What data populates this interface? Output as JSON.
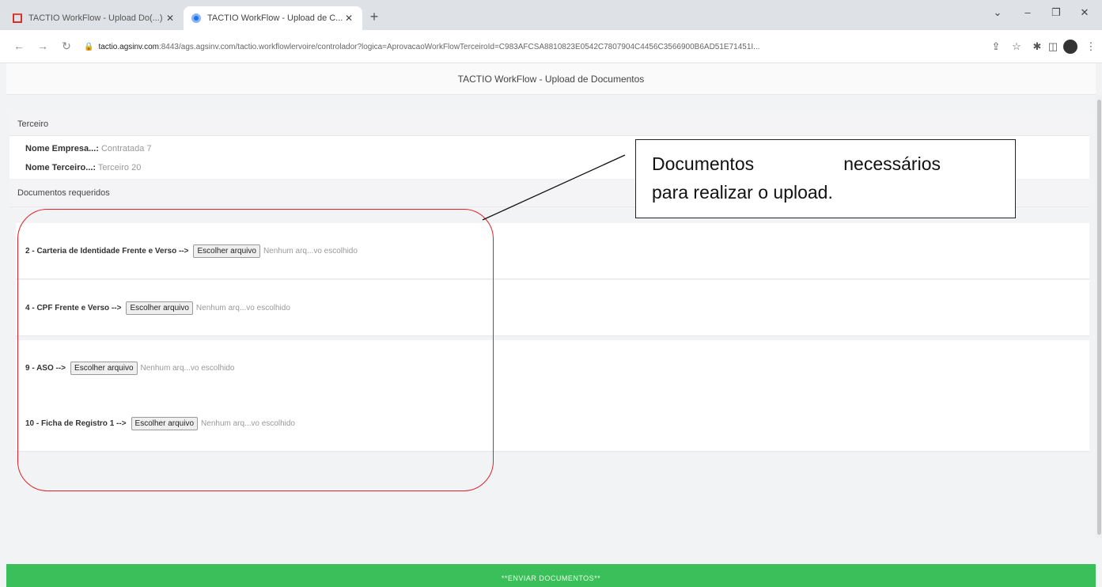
{
  "browser": {
    "tabs": [
      {
        "title": "TACTIO WorkFlow - Upload Do(...)",
        "icon": "gmail-icon"
      },
      {
        "title": "TACTIO WorkFlow - Upload de C...",
        "icon": "site-icon"
      }
    ],
    "new_tab": "+",
    "address": {
      "host": "tactio.agsinv.com",
      "rest": ":8443/ags.agsinv.com/tactio.workflowlervoire/controlador?logica=AprovacaoWorkFlowTerceiroId=C983AFCSA8810823E0542C7807904C4456C3566900B6AD51E71451I..."
    },
    "window_controls": {
      "minimize": "–",
      "restore": "❐",
      "close": "✕"
    }
  },
  "page": {
    "header_title": "TACTIO WorkFlow - Upload de Documentos",
    "terceiro_heading": "Terceiro",
    "nome_empresa_label": "Nome Empresa...:",
    "nome_empresa_value": "Contratada 7",
    "nome_terceiro_label": "Nome Terceiro...:",
    "nome_terceiro_value": "Terceiro 20",
    "documentos_heading": "Documentos requeridos",
    "documents": [
      {
        "label": "2 - Carteria de Identidade Frente e Verso -->",
        "button": "Escolher arquivo",
        "status": "Nenhum arq...vo escolhido"
      },
      {
        "label": "4 - CPF Frente e Verso -->",
        "button": "Escolher arquivo",
        "status": "Nenhum arq...vo escolhido"
      },
      {
        "label": "9 - ASO -->",
        "button": "Escolher arquivo",
        "status": "Nenhum arq...vo escolhido"
      },
      {
        "label": "10 - Ficha de Registro 1 -->",
        "button": "Escolher arquivo",
        "status": "Nenhum arq...vo escolhido"
      }
    ],
    "submit_label": "**ENVIAR DOCUMENTOS**"
  },
  "annotation": {
    "line1_a": "Documentos",
    "line1_b": "necessários",
    "line2": "para realizar o upload."
  },
  "colors": {
    "submit_bg": "#3bbf5a",
    "highlight": "#e0202a"
  }
}
